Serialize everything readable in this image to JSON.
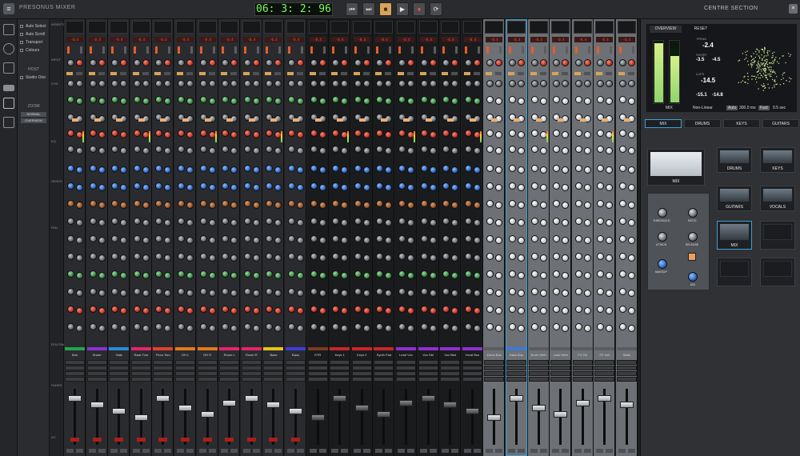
{
  "app": {
    "title": "PRESONUS MIXER",
    "menu_icon": "menu-icon"
  },
  "transport": {
    "timecode": "06: 3: 2: 96",
    "buttons": [
      {
        "name": "rewind",
        "glyph": "⏮"
      },
      {
        "name": "play-start",
        "glyph": "⏭"
      },
      {
        "name": "stop",
        "glyph": "■"
      },
      {
        "name": "play",
        "glyph": "▶"
      },
      {
        "name": "record",
        "glyph": "●"
      },
      {
        "name": "loop",
        "glyph": "⟳"
      }
    ]
  },
  "options": {
    "items": [
      "Auto Select",
      "Auto Scroll",
      "Transport",
      "Colours"
    ],
    "host_heading": "HOST",
    "host_item": "Studio One",
    "zoom_heading": "ZOOM",
    "zoom_buttons": [
      "NORMAL",
      "OVERVIEW"
    ]
  },
  "rowlabels": [
    "INSERTS",
    "INPUT",
    "DYN",
    "EQ",
    "SENDS",
    "PAN",
    "ROUTING",
    "FADER",
    "I/O"
  ],
  "centre": {
    "title": "CENTRE SECTION",
    "meter": {
      "tabs": [
        "OVERVIEW",
        "RESET"
      ],
      "peak_label": "TPEAK",
      "peak_value": "-2.4",
      "short_label": "SHORT",
      "short_l": "-3.5",
      "short_r": "-4.5",
      "lufs_label": "LUFS",
      "lufs_value": "-14.5",
      "range_l": "-15.1",
      "range_r": "-14.8",
      "bottom": [
        "MIX",
        "Non-Linear",
        "Auto",
        "300.0 ms",
        "Fast",
        "0.5 sec"
      ]
    },
    "bus_tabs": [
      "MIX",
      "DRUMS",
      "KEYS",
      "GUITARS"
    ],
    "vu_modules": [
      {
        "label": "MIX",
        "style": "light"
      },
      {
        "label": "DRUMS",
        "style": "dark"
      },
      {
        "label": "KEYS",
        "style": "dark"
      },
      {
        "label": "GUITARS",
        "style": "dark"
      },
      {
        "label": "VOCALS",
        "style": "dark"
      },
      {
        "label": "MIX",
        "style": "dark"
      },
      {
        "label": "",
        "style": "empty"
      },
      {
        "label": "",
        "style": "empty"
      },
      {
        "label": "",
        "style": "empty"
      }
    ],
    "compressor_labels": [
      "THRESHOLD",
      "RATIO",
      "ATTACK",
      "RELEASE",
      "MAKEUP",
      "MIX"
    ]
  },
  "channels": [
    {
      "name": "Kick",
      "color": "#1fa74a",
      "tone": "dk"
    },
    {
      "name": "Snare",
      "color": "#8e2fd2",
      "tone": "dk"
    },
    {
      "name": "Hats",
      "color": "#2a8ad8",
      "tone": "dk"
    },
    {
      "name": "Rack Tom",
      "color": "#e8246a",
      "tone": "dk"
    },
    {
      "name": "Floor Tom",
      "color": "#e0442a",
      "tone": "dk"
    },
    {
      "name": "OH L",
      "color": "#e07a1a",
      "tone": "dk"
    },
    {
      "name": "OH R",
      "color": "#e07a1a",
      "tone": "dk"
    },
    {
      "name": "Room L",
      "color": "#e8246a",
      "tone": "dk"
    },
    {
      "name": "Room R",
      "color": "#e8246a",
      "tone": "dk"
    },
    {
      "name": "Bass",
      "color": "#e8c21a",
      "tone": "dk"
    },
    {
      "name": "Bass",
      "color": "#3a3fd8",
      "tone": "dk"
    },
    {
      "name": "GTR",
      "color": "#7a3a20",
      "tone": "bl"
    },
    {
      "name": "Keys 1",
      "color": "#c8262a",
      "tone": "bl"
    },
    {
      "name": "Keys 2",
      "color": "#c8262a",
      "tone": "bl"
    },
    {
      "name": "Synth Pad",
      "color": "#c8262a",
      "tone": "bl"
    },
    {
      "name": "Lead Vox",
      "color": "#8e2fd2",
      "tone": "bl"
    },
    {
      "name": "Vox Dbl",
      "color": "#8e2fd2",
      "tone": "bl"
    },
    {
      "name": "Vox Bkd",
      "color": "#8e2fd2",
      "tone": "bl"
    },
    {
      "name": "Vocal Bus",
      "color": "#8e2fd2",
      "tone": "bl"
    },
    {
      "name": "Drum Bus",
      "color": "#5a5c60",
      "tone": "lt"
    },
    {
      "name": "Bass Bus",
      "color": "#3a7ad8",
      "tone": "lt",
      "selected": true
    },
    {
      "name": "Drum Verb",
      "color": "#5a5c60",
      "tone": "lt"
    },
    {
      "name": "Lead Verb",
      "color": "#5a5c60",
      "tone": "lt"
    },
    {
      "name": "FX Gtr",
      "color": "#5a5c60",
      "tone": "lt"
    },
    {
      "name": "FX Vox",
      "color": "#5a5c60",
      "tone": "lt"
    },
    {
      "name": "Main",
      "color": "#5a5c60",
      "tone": "lt"
    }
  ]
}
